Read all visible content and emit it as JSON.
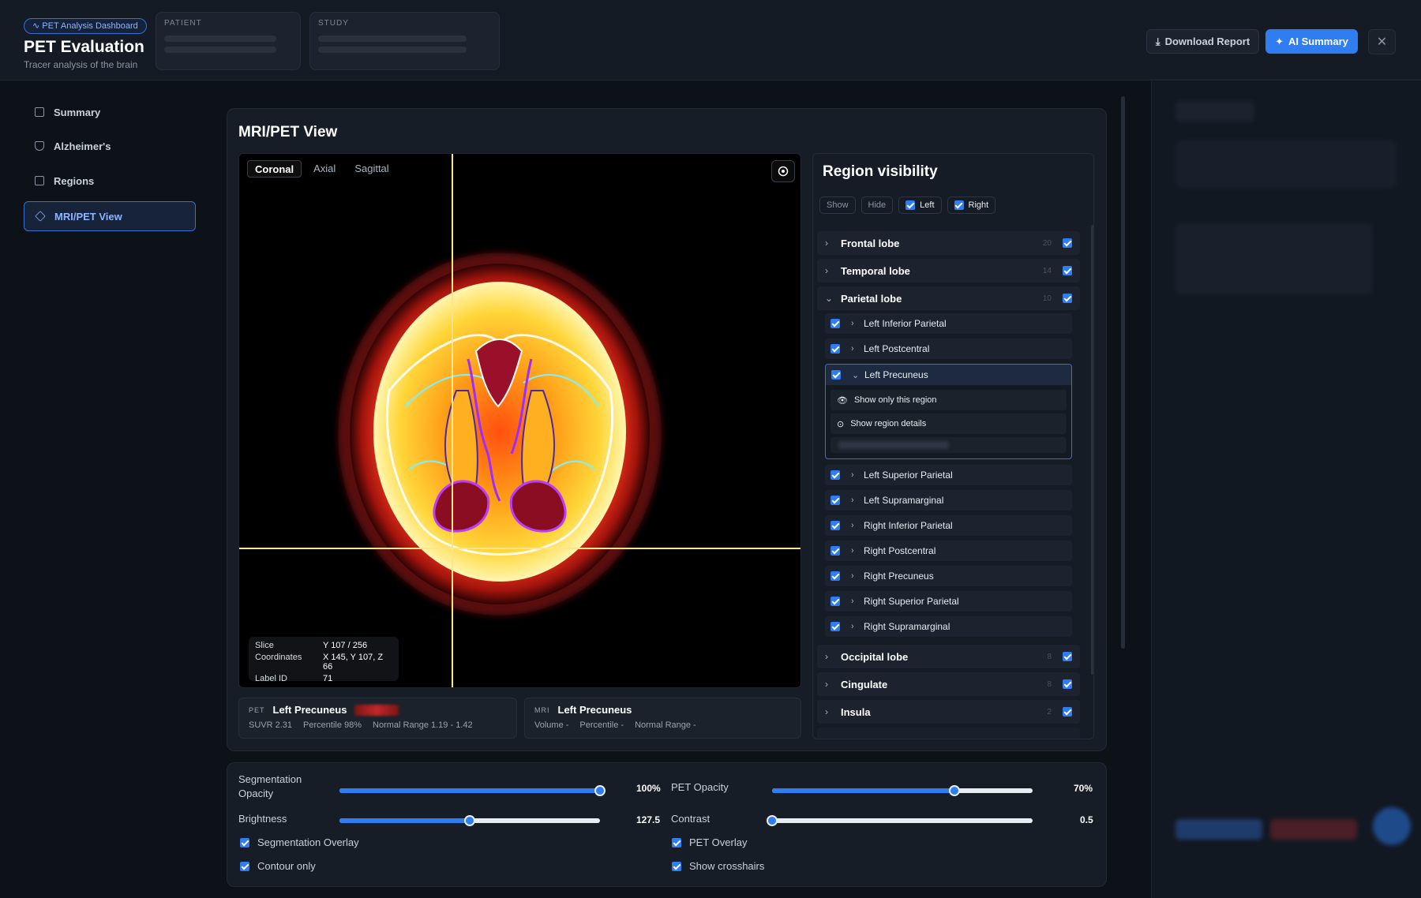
{
  "header": {
    "badge": "PET Analysis Dashboard",
    "title": "PET Evaluation",
    "subtitle": "Tracer analysis of the brain",
    "patient_label": "PATIENT",
    "study_label": "STUDY",
    "download_label": "Download Report",
    "ai_label": "AI Summary"
  },
  "sidebar": {
    "items": [
      {
        "label": "Summary",
        "icon": "document-icon"
      },
      {
        "label": "Alzheimer's",
        "icon": "shield-icon"
      },
      {
        "label": "Regions",
        "icon": "document-icon"
      },
      {
        "label": "MRI/PET View",
        "icon": "layers-icon",
        "active": true
      }
    ]
  },
  "viewer": {
    "title": "MRI/PET View",
    "tabs": [
      "Coronal",
      "Axial",
      "Sagittal"
    ],
    "active_tab": "Coronal",
    "info": {
      "slice_label": "Slice",
      "slice_value": "Y 107 / 256",
      "coords_label": "Coordinates",
      "coords_value": "X 145, Y 107, Z 66",
      "label_label": "Label ID",
      "label_value": "71"
    }
  },
  "pet_card": {
    "tag": "PET",
    "name": "Left Precuneus",
    "suvr": "SUVR 2.31",
    "percentile": "Percentile 98%",
    "range": "Normal Range 1.19 - 1.42"
  },
  "mri_card": {
    "tag": "MRI",
    "name": "Left Precuneus",
    "volume": "Volume -",
    "percentile": "Percentile -",
    "range": "Normal Range -"
  },
  "regions": {
    "title": "Region visibility",
    "show": "Show",
    "hide": "Hide",
    "left": "Left",
    "right": "Right",
    "lobes_top": [
      {
        "name": "Frontal lobe",
        "count": "20",
        "chev": "›"
      },
      {
        "name": "Temporal lobe",
        "count": "14",
        "chev": "›"
      },
      {
        "name": "Parietal lobe",
        "count": "10",
        "chev": "⌄"
      }
    ],
    "parietal_subs_a": [
      "Left Inferior Parietal",
      "Left Postcentral"
    ],
    "expanded": {
      "name": "Left Precuneus",
      "opt1": "Show only this region",
      "opt2": "Show region details"
    },
    "parietal_subs_b": [
      "Left Superior Parietal",
      "Left Supramarginal",
      "Right Inferior Parietal",
      "Right Postcentral",
      "Right Precuneus",
      "Right Superior Parietal",
      "Right Supramarginal"
    ],
    "lobes_bottom": [
      {
        "name": "Occipital lobe",
        "count": "8",
        "chev": "›"
      },
      {
        "name": "Cingulate",
        "count": "8",
        "chev": "›"
      },
      {
        "name": "Insula",
        "count": "2",
        "chev": "›"
      }
    ]
  },
  "controls": {
    "seg_opacity_label": "Segmentation Opacity",
    "seg_opacity_value": "100%",
    "seg_opacity": 1.0,
    "pet_opacity_label": "PET Opacity",
    "pet_opacity_value": "70%",
    "pet_opacity": 0.7,
    "brightness_label": "Brightness",
    "brightness_value": "127.5",
    "brightness": 0.5,
    "contrast_label": "Contrast",
    "contrast_value": "0.5",
    "contrast": 0.0,
    "seg_overlay": "Segmentation Overlay",
    "contour_only": "Contour only",
    "pet_overlay": "PET Overlay",
    "show_crosshairs": "Show crosshairs"
  }
}
